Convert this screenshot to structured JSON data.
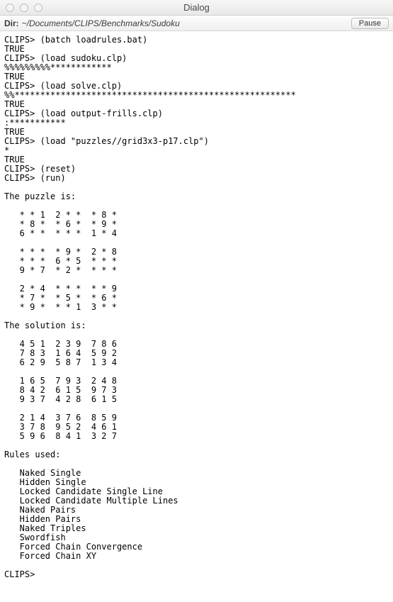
{
  "window": {
    "title": "Dialog"
  },
  "toolbar": {
    "dir_label": "Dir:",
    "dir_path": "~/Documents/CLIPS/Benchmarks/Sudoku",
    "pause_label": "Pause"
  },
  "terminal": {
    "content": "CLIPS> (batch loadrules.bat)\nTRUE\nCLIPS> (load sudoku.clp)\n%%%%%%%%%************\nTRUE\nCLIPS> (load solve.clp)\n%%*******************************************************\nTRUE\nCLIPS> (load output-frills.clp)\n:***********\nTRUE\nCLIPS> (load \"puzzles//grid3x3-p17.clp\")\n*\nTRUE\nCLIPS> (reset)\nCLIPS> (run)\n\nThe puzzle is:\n\n   * * 1  2 * *  * 8 *\n   * 8 *  * 6 *  * 9 *\n   6 * *  * * *  1 * 4\n\n   * * *  * 9 *  2 * 8\n   * * *  6 * 5  * * *\n   9 * 7  * 2 *  * * *\n\n   2 * 4  * * *  * * 9\n   * 7 *  * 5 *  * 6 *\n   * 9 *  * * 1  3 * *\n\nThe solution is:\n\n   4 5 1  2 3 9  7 8 6\n   7 8 3  1 6 4  5 9 2\n   6 2 9  5 8 7  1 3 4\n\n   1 6 5  7 9 3  2 4 8\n   8 4 2  6 1 5  9 7 3\n   9 3 7  4 2 8  6 1 5\n\n   2 1 4  3 7 6  8 5 9\n   3 7 8  9 5 2  4 6 1\n   5 9 6  8 4 1  3 2 7\n\nRules used:\n\n   Naked Single\n   Hidden Single\n   Locked Candidate Single Line\n   Locked Candidate Multiple Lines\n   Naked Pairs\n   Hidden Pairs\n   Naked Triples\n   Swordfish\n   Forced Chain Convergence\n   Forced Chain XY\n\nCLIPS> "
  }
}
